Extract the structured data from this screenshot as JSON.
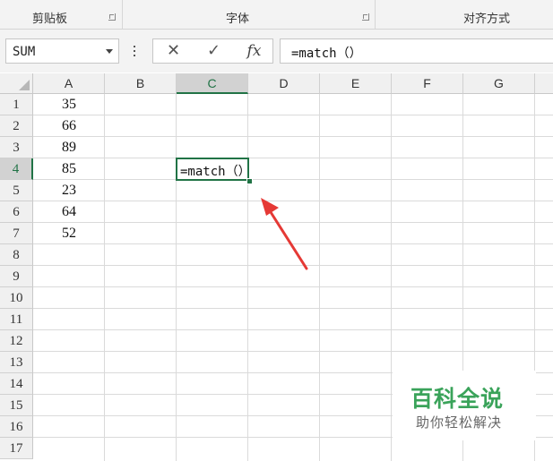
{
  "ribbon": {
    "groups": [
      {
        "label": "剪贴板"
      },
      {
        "label": "字体"
      },
      {
        "label": "对齐方式"
      }
    ]
  },
  "formula_bar": {
    "name_box": "SUM",
    "cancel_icon": "✕",
    "enter_icon": "✓",
    "fx_label": "fx",
    "formula": "=match（）"
  },
  "sheet": {
    "columns": [
      "A",
      "B",
      "C",
      "D",
      "E",
      "F",
      "G"
    ],
    "active_column": "C",
    "rows": [
      "1",
      "2",
      "3",
      "4",
      "5",
      "6",
      "7",
      "8",
      "9",
      "10",
      "11",
      "12",
      "13",
      "14",
      "15",
      "16",
      "17"
    ],
    "active_row": "4",
    "column_a_values": [
      "35",
      "66",
      "89",
      "85",
      "23",
      "64",
      "52"
    ],
    "active_cell_text": "=match（）"
  },
  "watermark": {
    "title": "百科全说",
    "subtitle": "助你轻松解决"
  },
  "colors": {
    "accent_green": "#217346",
    "arrow_red": "#e53935",
    "watermark_green": "#3aa35a"
  }
}
